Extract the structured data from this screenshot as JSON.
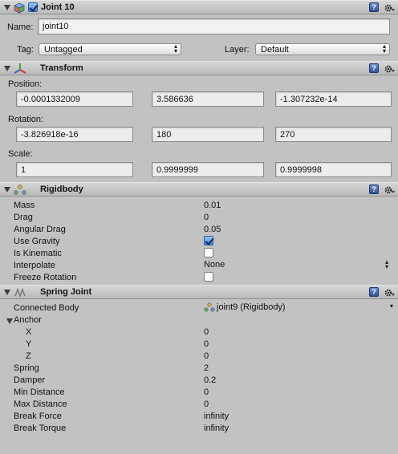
{
  "gameobject": {
    "title": "Joint 10",
    "name_label": "Name:",
    "name_value": "joint10",
    "tag_label": "Tag:",
    "tag_value": "Untagged",
    "layer_label": "Layer:",
    "layer_value": "Default",
    "active": true
  },
  "transform": {
    "title": "Transform",
    "position_label": "Position:",
    "position": [
      "-0.0001332009",
      "3.586636",
      "-1.307232e-14"
    ],
    "rotation_label": "Rotation:",
    "rotation": [
      "-3.826918e-16",
      "180",
      "270"
    ],
    "scale_label": "Scale:",
    "scale": [
      "1",
      "0.9999999",
      "0.9999998"
    ]
  },
  "rigidbody": {
    "title": "Rigidbody",
    "rows": [
      {
        "label": "Mass",
        "value": "0.01"
      },
      {
        "label": "Drag",
        "value": "0"
      },
      {
        "label": "Angular Drag",
        "value": "0.05"
      },
      {
        "label": "Use Gravity",
        "checked": true
      },
      {
        "label": "Is Kinematic",
        "checked": false
      },
      {
        "label": "Interpolate",
        "value": "None"
      },
      {
        "label": "Freeze Rotation",
        "checked": false
      }
    ]
  },
  "spring_joint": {
    "title": "Spring Joint",
    "connected_body_label": "Connected Body",
    "connected_body_value": "joint9 (Rigidbody)",
    "anchor_label": "Anchor",
    "anchor": [
      {
        "label": "X",
        "value": "0"
      },
      {
        "label": "Y",
        "value": "0"
      },
      {
        "label": "Z",
        "value": "0"
      }
    ],
    "rows": [
      {
        "label": "Spring",
        "value": "2"
      },
      {
        "label": "Damper",
        "value": "0.2"
      },
      {
        "label": "Min Distance",
        "value": "0"
      },
      {
        "label": "Max Distance",
        "value": "0"
      },
      {
        "label": "Break Force",
        "value": "infinity"
      },
      {
        "label": "Break Torque",
        "value": "infinity"
      }
    ]
  },
  "icons": {
    "help": "?",
    "colors": {
      "help": "#3f62a8",
      "checked": "#3d83d8",
      "panel": "#c2c2c2"
    }
  }
}
